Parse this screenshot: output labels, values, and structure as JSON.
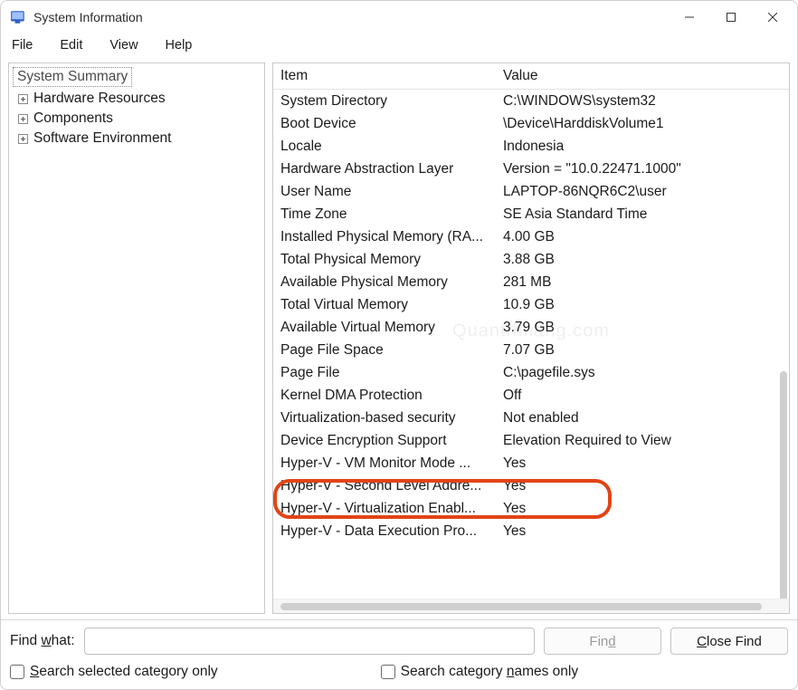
{
  "window": {
    "title": "System Information"
  },
  "menubar": {
    "file": "File",
    "edit": "Edit",
    "view": "View",
    "help": "Help"
  },
  "tree": {
    "root": "System Summary",
    "items": [
      "Hardware Resources",
      "Components",
      "Software Environment"
    ]
  },
  "details": {
    "columns": {
      "item": "Item",
      "value": "Value"
    },
    "rows": [
      {
        "item": "System Directory",
        "value": "C:\\WINDOWS\\system32"
      },
      {
        "item": "Boot Device",
        "value": "\\Device\\HarddiskVolume1"
      },
      {
        "item": "Locale",
        "value": "Indonesia"
      },
      {
        "item": "Hardware Abstraction Layer",
        "value": "Version = \"10.0.22471.1000\""
      },
      {
        "item": "User Name",
        "value": "LAPTOP-86NQR6C2\\user"
      },
      {
        "item": "Time Zone",
        "value": "SE Asia Standard Time"
      },
      {
        "item": "Installed Physical Memory (RA...",
        "value": "4.00 GB"
      },
      {
        "item": "Total Physical Memory",
        "value": "3.88 GB"
      },
      {
        "item": "Available Physical Memory",
        "value": "281 MB"
      },
      {
        "item": "Total Virtual Memory",
        "value": "10.9 GB"
      },
      {
        "item": "Available Virtual Memory",
        "value": "3.79 GB"
      },
      {
        "item": "Page File Space",
        "value": "7.07 GB"
      },
      {
        "item": "Page File",
        "value": "C:\\pagefile.sys"
      },
      {
        "item": "Kernel DMA Protection",
        "value": "Off"
      },
      {
        "item": "Virtualization-based security",
        "value": "Not enabled"
      },
      {
        "item": "Device Encryption Support",
        "value": "Elevation Required to View"
      },
      {
        "item": "Hyper-V - VM Monitor Mode ...",
        "value": "Yes"
      },
      {
        "item": "Hyper-V - Second Level Addre...",
        "value": "Yes"
      },
      {
        "item": "Hyper-V - Virtualization Enabl...",
        "value": "Yes"
      },
      {
        "item": "Hyper-V - Data Execution Pro...",
        "value": "Yes"
      }
    ]
  },
  "watermark": "Quantrimang.com",
  "find": {
    "label_prefix": "Find ",
    "label_ul": "w",
    "label_suffix": "hat:",
    "value": "",
    "find_btn_prefix": "Fin",
    "find_btn_ul": "d",
    "close_btn_ul": "C",
    "close_btn_suffix": "lose Find",
    "check1_ul": "S",
    "check1_suffix": "earch selected category only",
    "check2_prefix": "Search category ",
    "check2_ul": "n",
    "check2_suffix": "ames only"
  }
}
